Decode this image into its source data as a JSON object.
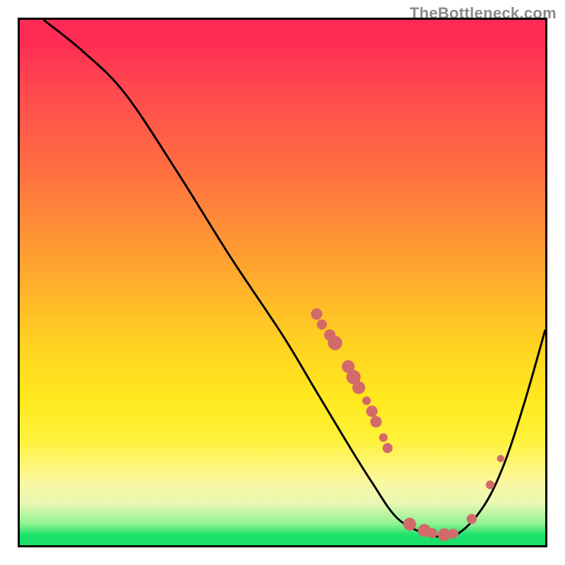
{
  "watermark": "TheBottleneck.com",
  "chart_data": {
    "type": "line",
    "title": "",
    "xlabel": "",
    "ylabel": "",
    "xlim": [
      0,
      100
    ],
    "ylim": [
      0,
      100
    ],
    "axes_hidden": true,
    "grid": false,
    "curve_points": [
      {
        "x": 4.5,
        "y": 100
      },
      {
        "x": 12,
        "y": 94
      },
      {
        "x": 20,
        "y": 86
      },
      {
        "x": 30,
        "y": 71
      },
      {
        "x": 40,
        "y": 55
      },
      {
        "x": 50,
        "y": 40
      },
      {
        "x": 56,
        "y": 30
      },
      {
        "x": 62,
        "y": 20
      },
      {
        "x": 67,
        "y": 12
      },
      {
        "x": 72,
        "y": 5
      },
      {
        "x": 78,
        "y": 2
      },
      {
        "x": 83,
        "y": 2
      },
      {
        "x": 88,
        "y": 7
      },
      {
        "x": 92,
        "y": 15
      },
      {
        "x": 96,
        "y": 27
      },
      {
        "x": 100,
        "y": 41
      }
    ],
    "series": [
      {
        "name": "markers",
        "style": "scatter",
        "color": "#d36a6a",
        "points": [
          {
            "x": 56.5,
            "y": 44.0,
            "r": 8
          },
          {
            "x": 57.5,
            "y": 42.0,
            "r": 7
          },
          {
            "x": 59.0,
            "y": 40.0,
            "r": 8
          },
          {
            "x": 60.0,
            "y": 38.5,
            "r": 10
          },
          {
            "x": 62.5,
            "y": 34.0,
            "r": 9
          },
          {
            "x": 63.5,
            "y": 32.0,
            "r": 10
          },
          {
            "x": 64.5,
            "y": 30.0,
            "r": 9
          },
          {
            "x": 66.0,
            "y": 27.5,
            "r": 6
          },
          {
            "x": 67.0,
            "y": 25.5,
            "r": 8
          },
          {
            "x": 67.8,
            "y": 23.5,
            "r": 8
          },
          {
            "x": 69.2,
            "y": 20.5,
            "r": 6
          },
          {
            "x": 70.0,
            "y": 18.5,
            "r": 7
          },
          {
            "x": 74.2,
            "y": 4.0,
            "r": 9
          },
          {
            "x": 77.0,
            "y": 2.8,
            "r": 9
          },
          {
            "x": 78.5,
            "y": 2.3,
            "r": 7
          },
          {
            "x": 80.8,
            "y": 2.0,
            "r": 9
          },
          {
            "x": 82.5,
            "y": 2.2,
            "r": 7
          },
          {
            "x": 86.0,
            "y": 5.0,
            "r": 7
          },
          {
            "x": 89.5,
            "y": 11.5,
            "r": 6
          },
          {
            "x": 91.5,
            "y": 16.5,
            "r": 5
          }
        ]
      }
    ]
  }
}
